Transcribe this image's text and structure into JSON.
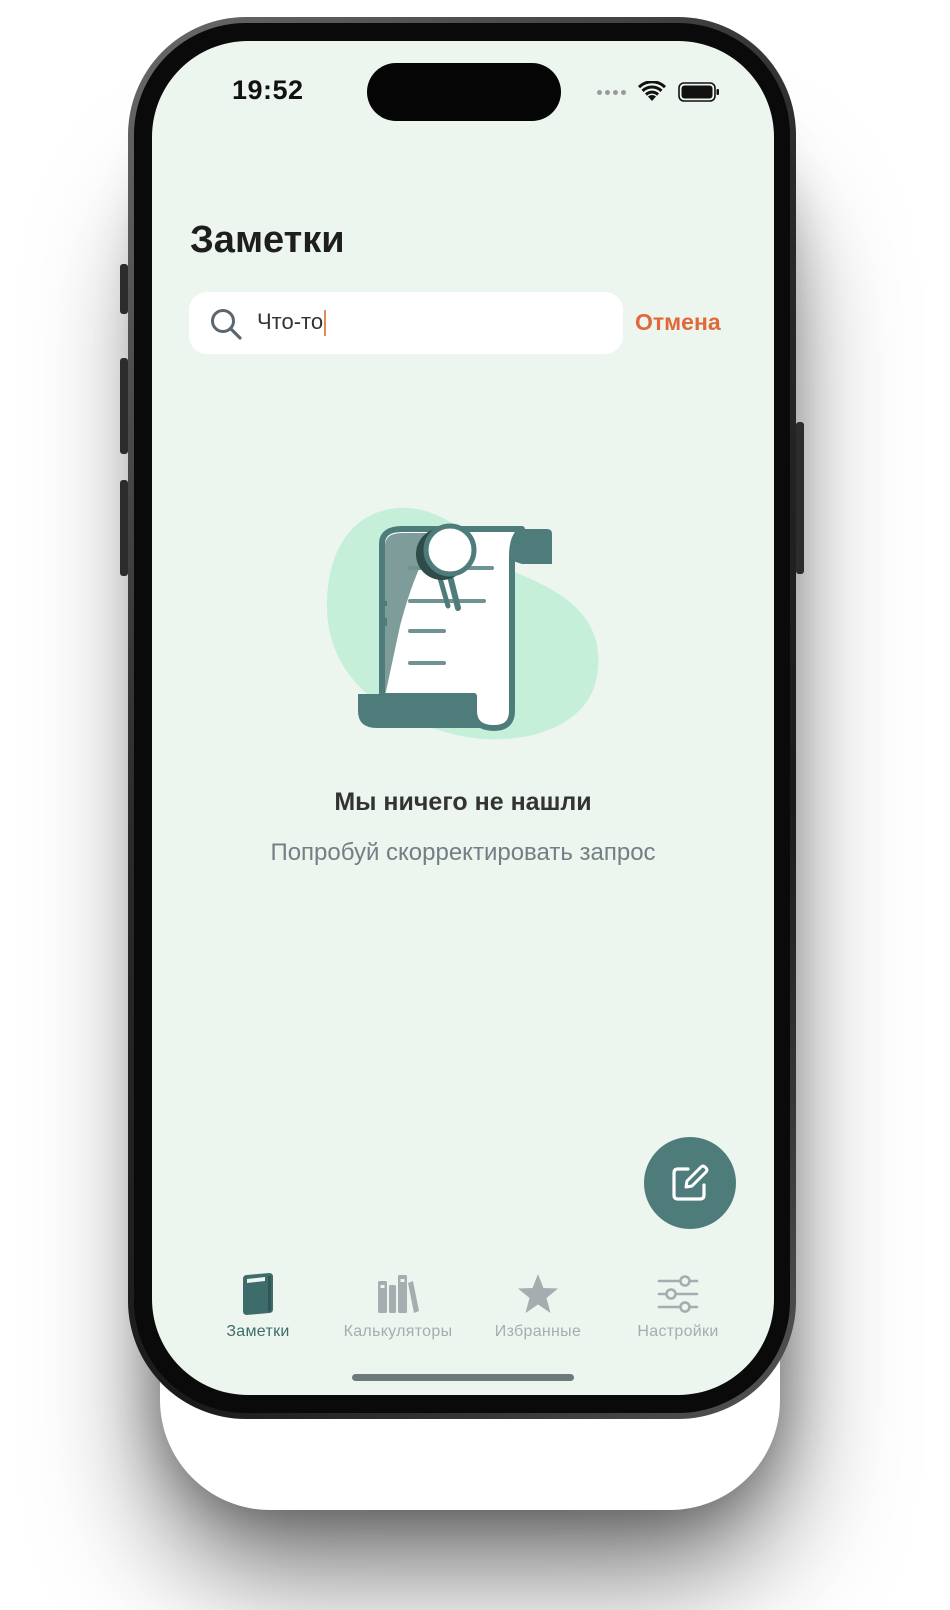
{
  "status_bar": {
    "time": "19:52"
  },
  "header": {
    "title": "Заметки"
  },
  "search": {
    "value": "Что-то",
    "cancel_label": "Отмена"
  },
  "empty_state": {
    "title": "Мы ничего не нашли",
    "subtitle": "Попробуй скорректировать запрос"
  },
  "tabbar": {
    "items": [
      {
        "label": "Заметки",
        "icon": "notebook-icon",
        "active": true
      },
      {
        "label": "Калькуляторы",
        "icon": "books-icon",
        "active": false
      },
      {
        "label": "Избранные",
        "icon": "star-icon",
        "active": false
      },
      {
        "label": "Настройки",
        "icon": "sliders-icon",
        "active": false
      }
    ]
  },
  "colors": {
    "background": "#edf5ef",
    "accent": "#4e7c7a",
    "cancel": "#e0693a",
    "inactive_tab": "#a6adb0"
  }
}
